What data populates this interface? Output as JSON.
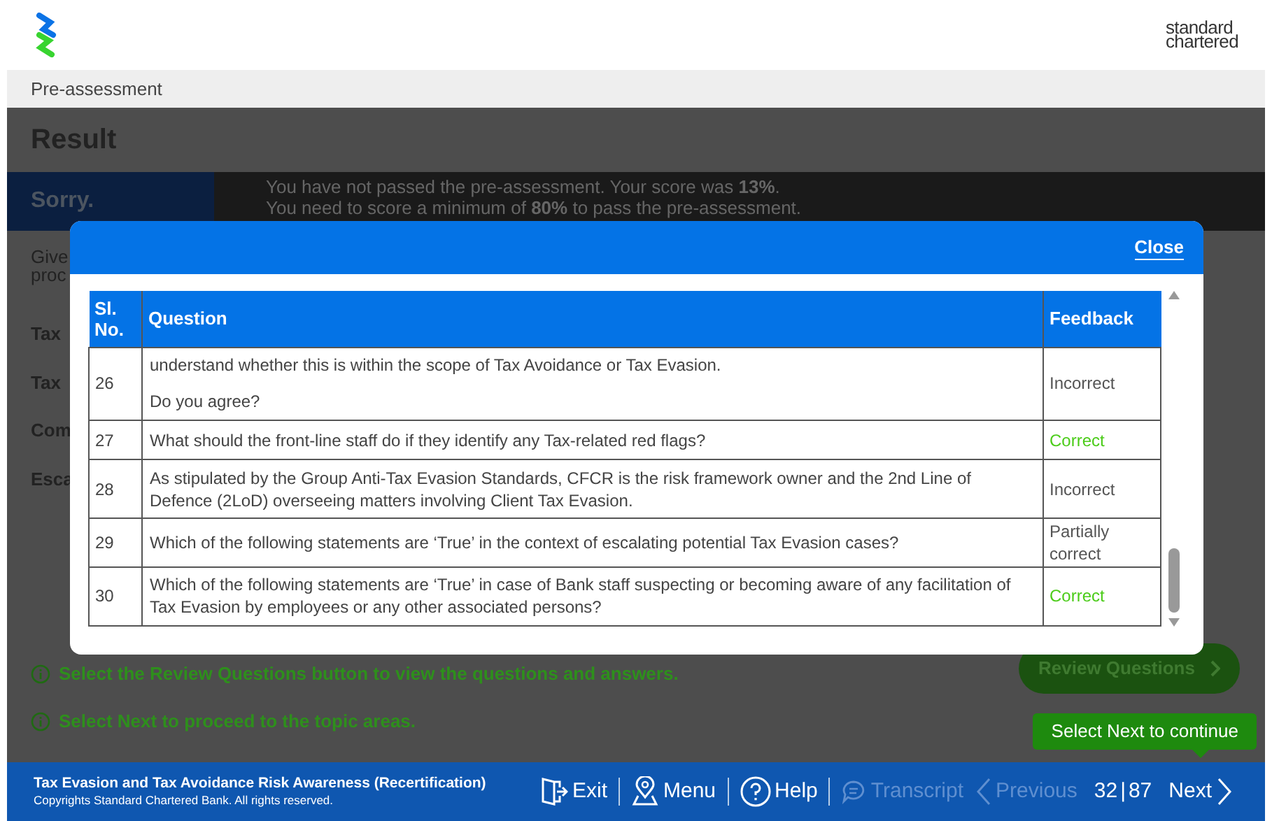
{
  "header": {
    "brand": [
      "standard",
      "chartered"
    ]
  },
  "breadcrumb": "Pre-assessment",
  "page": {
    "title": "Result",
    "banner": {
      "label": "Sorry.",
      "lines": [
        "You have not passed the pre-assessment. Your score was **13%**.",
        "You need to score a minimum of **80%** to pass the pre-assessment."
      ]
    },
    "background_fragments": [
      "Give",
      "proc",
      "Tax",
      "Tax",
      "Com",
      "Esca"
    ],
    "hints": [
      "Select the Review Questions button to view the questions and answers.",
      "Select Next to proceed to the topic areas."
    ],
    "review_button": "Review Questions",
    "tooltip": "Select Next to continue"
  },
  "modal": {
    "close": "Close",
    "columns": [
      "Sl. No.",
      "Question",
      "Feedback"
    ],
    "rows": [
      {
        "number": "26",
        "question": [
          "understand whether this is within the scope of Tax Avoidance or Tax Evasion.",
          "Do you agree?"
        ],
        "feedback": "Incorrect",
        "color": "#555555"
      },
      {
        "number": "27",
        "question": [
          "What should the front-line staff do if they identify any Tax-related red flags?"
        ],
        "feedback": "Correct",
        "color": "#4ccc1a"
      },
      {
        "number": "28",
        "question": [
          "As stipulated by the Group Anti-Tax Evasion Standards, CFCR is the risk framework owner and the 2nd Line of Defence (2LoD) overseeing matters involving Client Tax Evasion."
        ],
        "feedback": "Incorrect",
        "color": "#555555"
      },
      {
        "number": "29",
        "question": [
          "Which of the following statements are ‘True’ in the context of escalating potential Tax Evasion cases?"
        ],
        "feedback": "Partially correct",
        "color": "#555555"
      },
      {
        "number": "30",
        "question": [
          "Which of the following statements are ‘True’ in case of Bank staff suspecting or becoming aware of any facilitation of Tax Evasion by employees or any other associated persons?"
        ],
        "feedback": "Correct",
        "color": "#4ccc1a"
      }
    ]
  },
  "footer": {
    "course": "Tax Evasion and Tax Avoidance Risk Awareness (Recertification)",
    "copyright": "Copyrights Standard Chartered Bank. All rights reserved.",
    "nav": [
      {
        "kind": "exit",
        "label": "Exit",
        "disabled": false
      },
      {
        "kind": "menu",
        "label": "Menu",
        "disabled": false
      },
      {
        "kind": "help",
        "label": "Help",
        "disabled": false
      },
      {
        "kind": "transcript",
        "label": "Transcript",
        "disabled": true
      },
      {
        "kind": "previous",
        "label": "Previous",
        "disabled": true
      },
      {
        "kind": "page",
        "current": "32",
        "separator": "|",
        "total": "87"
      },
      {
        "kind": "next",
        "label": "Next",
        "disabled": false
      }
    ]
  }
}
